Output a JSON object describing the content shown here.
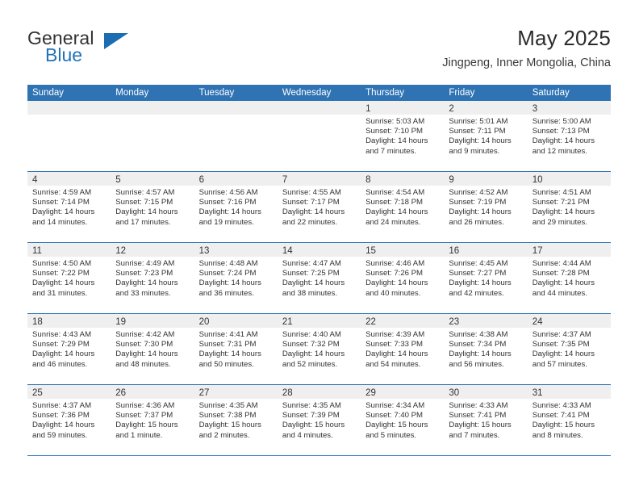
{
  "brand": {
    "name_part1": "General",
    "name_part2": "Blue",
    "logo_icon": "triangle-logo-icon"
  },
  "header": {
    "title": "May 2025",
    "subtitle": "Jingpeng, Inner Mongolia, China"
  },
  "colors": {
    "header_blue": "#2f73b4",
    "brand_blue": "#2472b8",
    "day_band_gray": "#efefef",
    "text": "#333333"
  },
  "calendar": {
    "weekday_headers": [
      "Sunday",
      "Monday",
      "Tuesday",
      "Wednesday",
      "Thursday",
      "Friday",
      "Saturday"
    ],
    "weeks": [
      [
        {
          "day": "",
          "empty": true,
          "lines": []
        },
        {
          "day": "",
          "empty": true,
          "lines": []
        },
        {
          "day": "",
          "empty": true,
          "lines": []
        },
        {
          "day": "",
          "empty": true,
          "lines": []
        },
        {
          "day": "1",
          "empty": false,
          "lines": [
            "Sunrise: 5:03 AM",
            "Sunset: 7:10 PM",
            "Daylight: 14 hours",
            "and 7 minutes."
          ]
        },
        {
          "day": "2",
          "empty": false,
          "lines": [
            "Sunrise: 5:01 AM",
            "Sunset: 7:11 PM",
            "Daylight: 14 hours",
            "and 9 minutes."
          ]
        },
        {
          "day": "3",
          "empty": false,
          "lines": [
            "Sunrise: 5:00 AM",
            "Sunset: 7:13 PM",
            "Daylight: 14 hours",
            "and 12 minutes."
          ]
        }
      ],
      [
        {
          "day": "4",
          "empty": false,
          "lines": [
            "Sunrise: 4:59 AM",
            "Sunset: 7:14 PM",
            "Daylight: 14 hours",
            "and 14 minutes."
          ]
        },
        {
          "day": "5",
          "empty": false,
          "lines": [
            "Sunrise: 4:57 AM",
            "Sunset: 7:15 PM",
            "Daylight: 14 hours",
            "and 17 minutes."
          ]
        },
        {
          "day": "6",
          "empty": false,
          "lines": [
            "Sunrise: 4:56 AM",
            "Sunset: 7:16 PM",
            "Daylight: 14 hours",
            "and 19 minutes."
          ]
        },
        {
          "day": "7",
          "empty": false,
          "lines": [
            "Sunrise: 4:55 AM",
            "Sunset: 7:17 PM",
            "Daylight: 14 hours",
            "and 22 minutes."
          ]
        },
        {
          "day": "8",
          "empty": false,
          "lines": [
            "Sunrise: 4:54 AM",
            "Sunset: 7:18 PM",
            "Daylight: 14 hours",
            "and 24 minutes."
          ]
        },
        {
          "day": "9",
          "empty": false,
          "lines": [
            "Sunrise: 4:52 AM",
            "Sunset: 7:19 PM",
            "Daylight: 14 hours",
            "and 26 minutes."
          ]
        },
        {
          "day": "10",
          "empty": false,
          "lines": [
            "Sunrise: 4:51 AM",
            "Sunset: 7:21 PM",
            "Daylight: 14 hours",
            "and 29 minutes."
          ]
        }
      ],
      [
        {
          "day": "11",
          "empty": false,
          "lines": [
            "Sunrise: 4:50 AM",
            "Sunset: 7:22 PM",
            "Daylight: 14 hours",
            "and 31 minutes."
          ]
        },
        {
          "day": "12",
          "empty": false,
          "lines": [
            "Sunrise: 4:49 AM",
            "Sunset: 7:23 PM",
            "Daylight: 14 hours",
            "and 33 minutes."
          ]
        },
        {
          "day": "13",
          "empty": false,
          "lines": [
            "Sunrise: 4:48 AM",
            "Sunset: 7:24 PM",
            "Daylight: 14 hours",
            "and 36 minutes."
          ]
        },
        {
          "day": "14",
          "empty": false,
          "lines": [
            "Sunrise: 4:47 AM",
            "Sunset: 7:25 PM",
            "Daylight: 14 hours",
            "and 38 minutes."
          ]
        },
        {
          "day": "15",
          "empty": false,
          "lines": [
            "Sunrise: 4:46 AM",
            "Sunset: 7:26 PM",
            "Daylight: 14 hours",
            "and 40 minutes."
          ]
        },
        {
          "day": "16",
          "empty": false,
          "lines": [
            "Sunrise: 4:45 AM",
            "Sunset: 7:27 PM",
            "Daylight: 14 hours",
            "and 42 minutes."
          ]
        },
        {
          "day": "17",
          "empty": false,
          "lines": [
            "Sunrise: 4:44 AM",
            "Sunset: 7:28 PM",
            "Daylight: 14 hours",
            "and 44 minutes."
          ]
        }
      ],
      [
        {
          "day": "18",
          "empty": false,
          "lines": [
            "Sunrise: 4:43 AM",
            "Sunset: 7:29 PM",
            "Daylight: 14 hours",
            "and 46 minutes."
          ]
        },
        {
          "day": "19",
          "empty": false,
          "lines": [
            "Sunrise: 4:42 AM",
            "Sunset: 7:30 PM",
            "Daylight: 14 hours",
            "and 48 minutes."
          ]
        },
        {
          "day": "20",
          "empty": false,
          "lines": [
            "Sunrise: 4:41 AM",
            "Sunset: 7:31 PM",
            "Daylight: 14 hours",
            "and 50 minutes."
          ]
        },
        {
          "day": "21",
          "empty": false,
          "lines": [
            "Sunrise: 4:40 AM",
            "Sunset: 7:32 PM",
            "Daylight: 14 hours",
            "and 52 minutes."
          ]
        },
        {
          "day": "22",
          "empty": false,
          "lines": [
            "Sunrise: 4:39 AM",
            "Sunset: 7:33 PM",
            "Daylight: 14 hours",
            "and 54 minutes."
          ]
        },
        {
          "day": "23",
          "empty": false,
          "lines": [
            "Sunrise: 4:38 AM",
            "Sunset: 7:34 PM",
            "Daylight: 14 hours",
            "and 56 minutes."
          ]
        },
        {
          "day": "24",
          "empty": false,
          "lines": [
            "Sunrise: 4:37 AM",
            "Sunset: 7:35 PM",
            "Daylight: 14 hours",
            "and 57 minutes."
          ]
        }
      ],
      [
        {
          "day": "25",
          "empty": false,
          "lines": [
            "Sunrise: 4:37 AM",
            "Sunset: 7:36 PM",
            "Daylight: 14 hours",
            "and 59 minutes."
          ]
        },
        {
          "day": "26",
          "empty": false,
          "lines": [
            "Sunrise: 4:36 AM",
            "Sunset: 7:37 PM",
            "Daylight: 15 hours",
            "and 1 minute."
          ]
        },
        {
          "day": "27",
          "empty": false,
          "lines": [
            "Sunrise: 4:35 AM",
            "Sunset: 7:38 PM",
            "Daylight: 15 hours",
            "and 2 minutes."
          ]
        },
        {
          "day": "28",
          "empty": false,
          "lines": [
            "Sunrise: 4:35 AM",
            "Sunset: 7:39 PM",
            "Daylight: 15 hours",
            "and 4 minutes."
          ]
        },
        {
          "day": "29",
          "empty": false,
          "lines": [
            "Sunrise: 4:34 AM",
            "Sunset: 7:40 PM",
            "Daylight: 15 hours",
            "and 5 minutes."
          ]
        },
        {
          "day": "30",
          "empty": false,
          "lines": [
            "Sunrise: 4:33 AM",
            "Sunset: 7:41 PM",
            "Daylight: 15 hours",
            "and 7 minutes."
          ]
        },
        {
          "day": "31",
          "empty": false,
          "lines": [
            "Sunrise: 4:33 AM",
            "Sunset: 7:41 PM",
            "Daylight: 15 hours",
            "and 8 minutes."
          ]
        }
      ]
    ]
  }
}
